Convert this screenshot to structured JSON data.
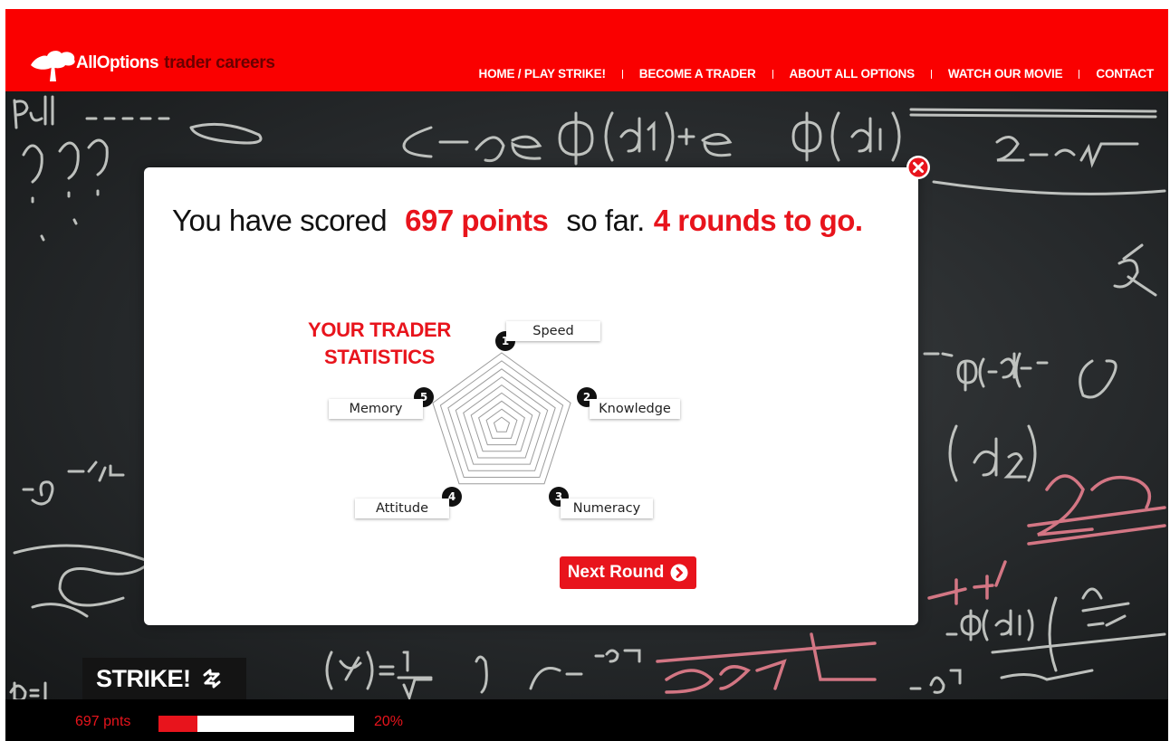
{
  "header": {
    "logo_brand": "AllOptions",
    "logo_tagline": "trader careers",
    "nav": [
      {
        "label": "HOME / PLAY STRIKE!"
      },
      {
        "label": "BECOME A TRADER"
      },
      {
        "label": "ABOUT ALL OPTIONS"
      },
      {
        "label": "WATCH OUR MOVIE"
      },
      {
        "label": "CONTACT"
      }
    ]
  },
  "modal": {
    "score_prefix": "You have scored",
    "score_points": "697 points",
    "score_middle": "so far.",
    "rounds_left": "4 rounds to go.",
    "stats_title_line1": "YOUR TRADER",
    "stats_title_line2": "STATISTICS",
    "stats": [
      {
        "num": "1",
        "label": "Speed"
      },
      {
        "num": "2",
        "label": "Knowledge"
      },
      {
        "num": "3",
        "label": "Numeracy"
      },
      {
        "num": "4",
        "label": "Attitude"
      },
      {
        "num": "5",
        "label": "Memory"
      }
    ],
    "next_button": "Next Round"
  },
  "game": {
    "title": "STRIKE!",
    "points": "697 pnts",
    "progress_value": 0.2,
    "progress_label": "20%"
  },
  "colors": {
    "brand_red": "#fa0000",
    "accent_red": "#e8141c",
    "dark_red": "#6a0000"
  },
  "icons": {
    "logo": "tree-icon",
    "close": "close-icon",
    "next": "chevron-right-circle-icon",
    "strike": "arrows-cycle-icon"
  }
}
